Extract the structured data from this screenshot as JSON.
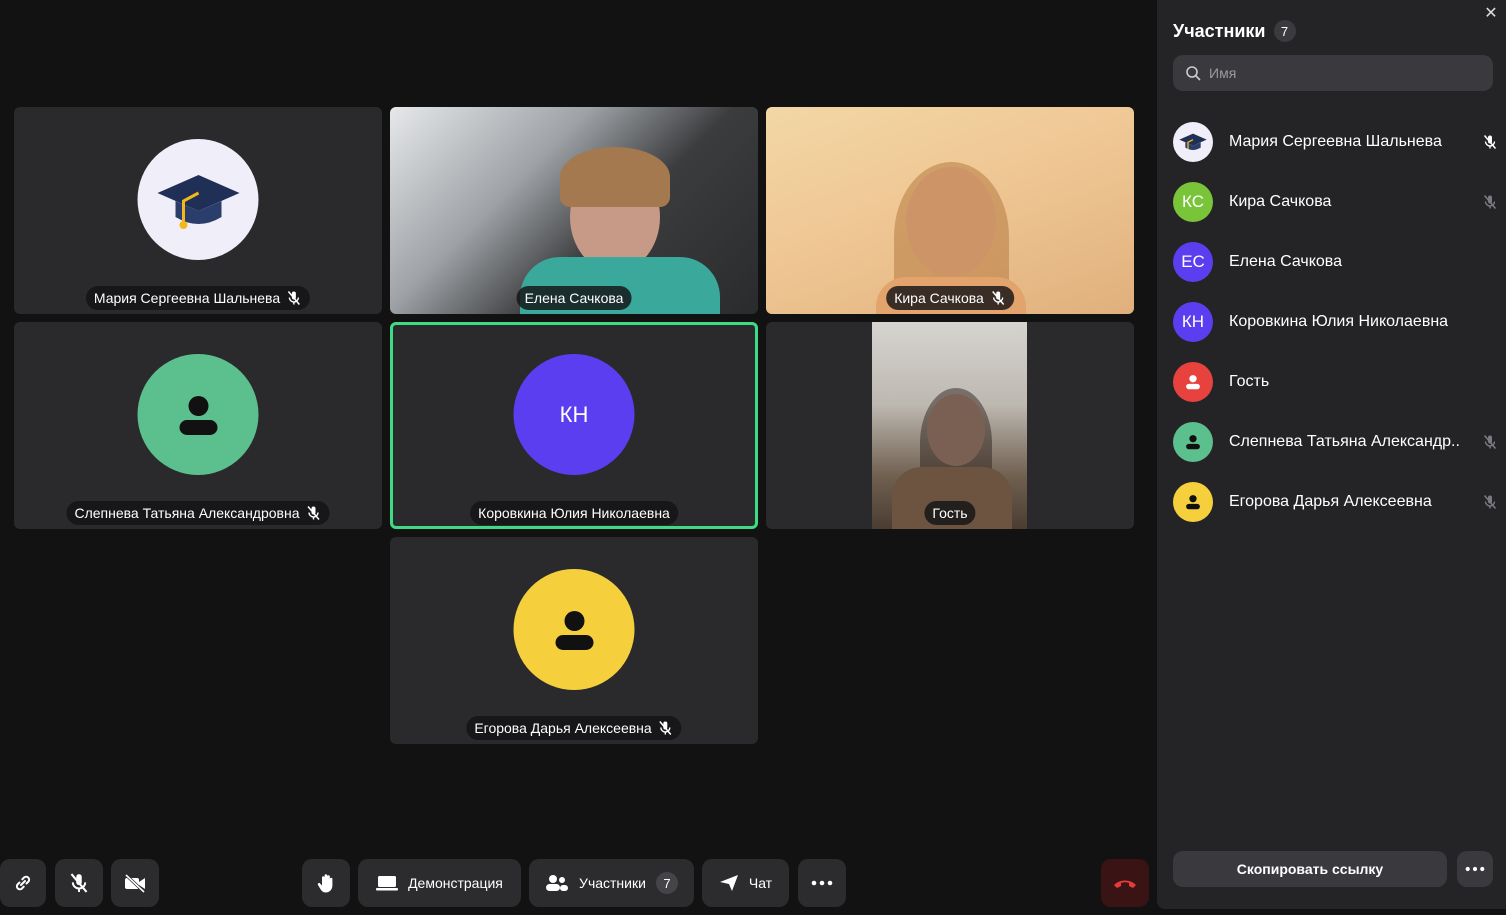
{
  "tiles": [
    {
      "name": "Мария Сергеевна Шальнева",
      "muted": true,
      "kind": "avatar-image",
      "icon": "graduation-cap-icon"
    },
    {
      "name": "Елена Сачкова",
      "muted": false,
      "kind": "video"
    },
    {
      "name": "Кира Сачкова",
      "muted": true,
      "kind": "video"
    },
    {
      "name": "Слепнева Татьяна Александровна",
      "muted": true,
      "kind": "avatar",
      "color": "#5cc08e"
    },
    {
      "name": "Коровкина Юлия Николаевна",
      "initials": "КН",
      "muted": false,
      "speaking": true,
      "kind": "initials",
      "color": "#5b3ef0"
    },
    {
      "name": "Гость",
      "muted": false,
      "kind": "video"
    },
    {
      "name": "Егорова Дарья Алексеевна",
      "muted": true,
      "kind": "avatar",
      "color": "#f5d03c"
    }
  ],
  "sidebar": {
    "title": "Участники",
    "count": "7",
    "search_placeholder": "Имя",
    "participants": [
      {
        "name": "Мария Сергеевна Шальнева",
        "icon": "graduation-cap-icon",
        "muted": true,
        "mic_color": "#ffffff"
      },
      {
        "name": "Кира Сачкова",
        "initials": "КС",
        "color": "#7ac43a",
        "muted": true,
        "mic_color": "#7a7a80"
      },
      {
        "name": "Елена Сачкова",
        "initials": "ЕС",
        "color": "#5b3ef0",
        "muted": false
      },
      {
        "name": "Коровкина Юлия Николаевна",
        "initials": "КН",
        "color": "#5b3ef0",
        "muted": false
      },
      {
        "name": "Гость",
        "color": "#e8423f",
        "muted": false,
        "icon": "person-icon"
      },
      {
        "name": "Слепнева Татьяна Александр..",
        "color": "#5cc08e",
        "muted": true,
        "mic_color": "#7a7a80",
        "icon": "person-icon"
      },
      {
        "name": "Егорова Дарья Алексеевна",
        "color": "#f5d03c",
        "muted": true,
        "mic_color": "#7a7a80",
        "icon": "person-icon"
      }
    ],
    "copy_link": "Скопировать ссылку"
  },
  "toolbar": {
    "demo_label": "Демонстрация",
    "participants_label": "Участники",
    "participants_count": "7",
    "chat_label": "Чат"
  },
  "colors": {
    "speaking_border": "#3ddc84",
    "hangup": "#d93a3a"
  }
}
